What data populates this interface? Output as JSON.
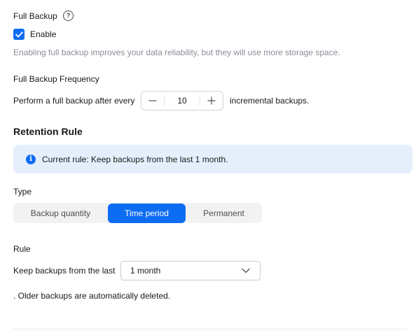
{
  "full_backup": {
    "title": "Full Backup",
    "help_icon": "question-circle-icon",
    "help_glyph": "?",
    "enable_label": "Enable",
    "enable_checked": true,
    "description": "Enabling full backup improves your data reliability, but they will use more storage space.",
    "frequency": {
      "title": "Full Backup Frequency",
      "prefix": "Perform a full backup after every",
      "value": "10",
      "suffix": "incremental backups.",
      "decrement_icon": "minus-icon",
      "increment_icon": "plus-icon"
    }
  },
  "retention": {
    "title": "Retention Rule",
    "info": {
      "icon": "info-icon",
      "glyph": "i",
      "text": "Current rule: Keep backups from the last 1 month."
    },
    "type": {
      "label": "Type",
      "options": [
        "Backup quantity",
        "Time period",
        "Permanent"
      ],
      "selected": "Time period"
    },
    "rule": {
      "label": "Rule",
      "prefix": "Keep backups from the last",
      "selected_value": "1 month",
      "dropdown_icon": "chevron-down-icon",
      "suffix": ". Older backups are automatically deleted."
    }
  },
  "colors": {
    "accent": "#0d6df2",
    "info_bg": "#e5effc",
    "hint_text": "#8a8e99",
    "text": "#191919"
  }
}
